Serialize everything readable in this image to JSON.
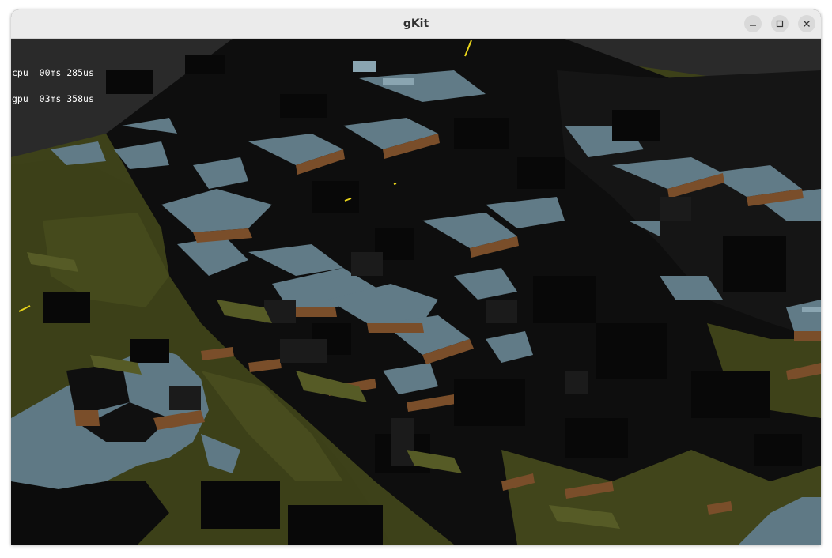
{
  "window": {
    "title": "gKit",
    "controls": [
      "minimize-icon",
      "maximize-icon",
      "close-icon"
    ]
  },
  "hud": {
    "cpu_label": "cpu",
    "cpu_value": "00ms 285us",
    "gpu_label": "gpu",
    "gpu_value": "03ms 358us"
  },
  "colors": {
    "sky": "#2a2a2a",
    "grass": "#3d4119",
    "grass_light": "#4e5222",
    "shadow": "#0b0b0b",
    "stone_top": "#607a86",
    "stone_light": "#7a96a3",
    "dirt": "#7a4e2a",
    "dark_side": "#141414",
    "light_line": "#e6d21a"
  }
}
